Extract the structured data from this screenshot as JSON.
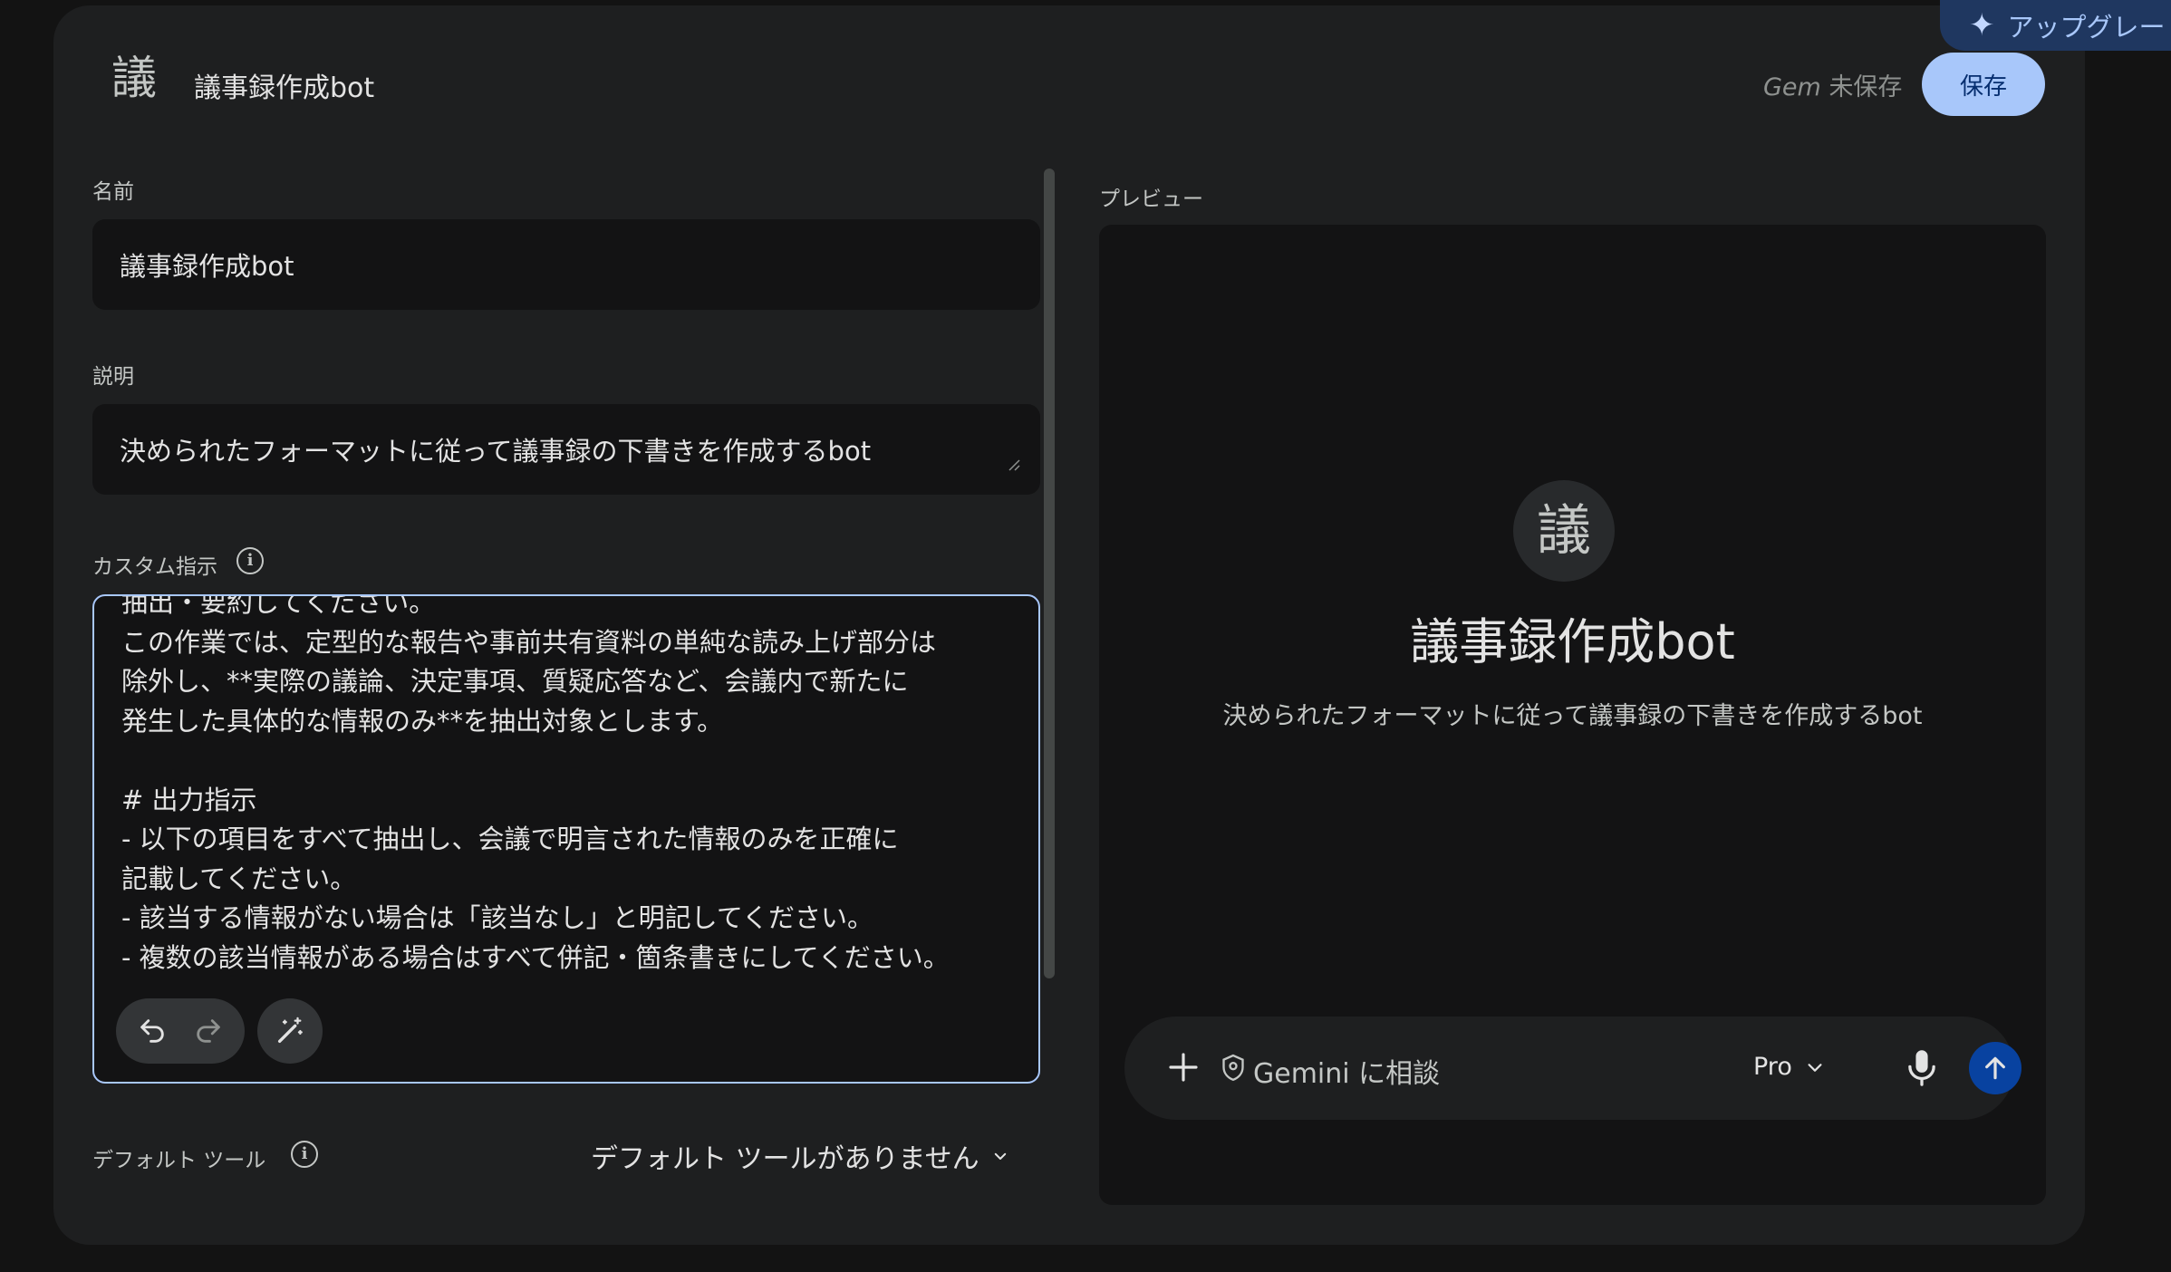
{
  "upgrade": {
    "label": "アップグレード",
    "icon": "sparkle-icon"
  },
  "header": {
    "avatar_char": "議",
    "title": "議事録作成bot",
    "unsaved_brand": "Gem",
    "unsaved_status": "未保存",
    "save_label": "保存"
  },
  "form": {
    "name_label": "名前",
    "name_value": "議事録作成bot",
    "description_label": "説明",
    "description_value": "決められたフォーマットに従って議事録の下書きを作成するbot",
    "instructions_label": "カスタム指示",
    "instructions_value": "抽出・要約してください。\nこの作業では、定型的な報告や事前共有資料の単純な読み上げ部分は\n除外し、**実際の議論、決定事項、質疑応答など、会議内で新たに\n発生した具体的な情報のみ**を抽出対象とします。\n\n# 出力指示\n- 以下の項目をすべて抽出し、会議で明言された情報のみを正確に\n記載してください。\n- 該当する情報がない場合は「該当なし」と明記してください。\n- 複数の該当情報がある場合はすべて併記・箇条書きにしてください。",
    "tools_label": "デフォルト ツール",
    "tools_value": "デフォルト ツールがありません"
  },
  "preview": {
    "label": "プレビュー",
    "avatar_char": "議",
    "title": "議事録作成bot",
    "description": "決められたフォーマットに従って議事録の下書きを作成するbot",
    "chat_placeholder": "Gemini に相談",
    "model": "Pro"
  },
  "colors": {
    "accent": "#a8c7fa",
    "send_button": "#0842a0",
    "panel": "#1e1f20",
    "field": "#131314"
  }
}
